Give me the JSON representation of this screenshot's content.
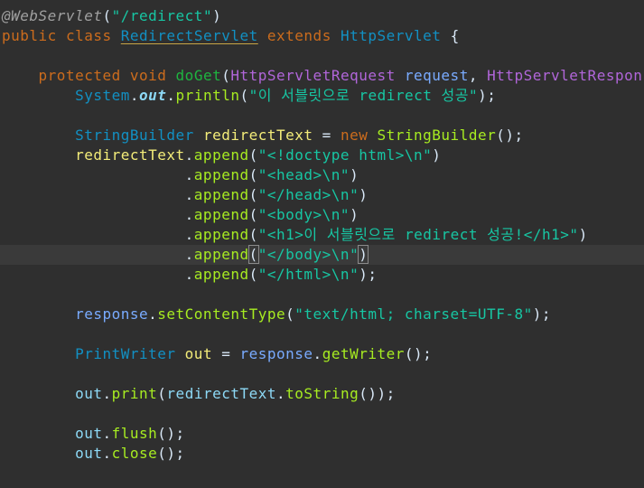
{
  "editor": {
    "lines": [
      [
        {
          "t": "@WebServlet",
          "c": "annotation"
        },
        {
          "t": "(",
          "c": "plain"
        },
        {
          "t": "\"/redirect\"",
          "c": "string"
        },
        {
          "t": ")",
          "c": "plain"
        }
      ],
      [
        {
          "t": "public",
          "c": "keyword"
        },
        {
          "t": " ",
          "c": "plain"
        },
        {
          "t": "class",
          "c": "keyword"
        },
        {
          "t": " ",
          "c": "plain"
        },
        {
          "t": "RedirectServlet",
          "c": "class-ul"
        },
        {
          "t": " ",
          "c": "plain"
        },
        {
          "t": "extends",
          "c": "keyword"
        },
        {
          "t": " ",
          "c": "plain"
        },
        {
          "t": "HttpServlet",
          "c": "class"
        },
        {
          "t": " {",
          "c": "plain"
        }
      ],
      [],
      [
        {
          "t": "    ",
          "c": "plain"
        },
        {
          "t": "protected",
          "c": "keyword"
        },
        {
          "t": " ",
          "c": "plain"
        },
        {
          "t": "void",
          "c": "keyword"
        },
        {
          "t": " ",
          "c": "plain"
        },
        {
          "t": "doGet",
          "c": "decl-method"
        },
        {
          "t": "(",
          "c": "plain"
        },
        {
          "t": "HttpServletRequest",
          "c": "interface"
        },
        {
          "t": " ",
          "c": "plain"
        },
        {
          "t": "request",
          "c": "param"
        },
        {
          "t": ", ",
          "c": "plain"
        },
        {
          "t": "HttpServletResponse",
          "c": "interface"
        }
      ],
      [
        {
          "t": "        ",
          "c": "plain"
        },
        {
          "t": "System",
          "c": "class"
        },
        {
          "t": ".",
          "c": "plain"
        },
        {
          "t": "out",
          "c": "static"
        },
        {
          "t": ".",
          "c": "plain"
        },
        {
          "t": "println",
          "c": "method"
        },
        {
          "t": "(",
          "c": "plain"
        },
        {
          "t": "\"이 서블릿으로 redirect 성공\"",
          "c": "string"
        },
        {
          "t": ");",
          "c": "plain"
        }
      ],
      [],
      [
        {
          "t": "        ",
          "c": "plain"
        },
        {
          "t": "StringBuilder",
          "c": "class"
        },
        {
          "t": " ",
          "c": "plain"
        },
        {
          "t": "redirectText",
          "c": "local"
        },
        {
          "t": " = ",
          "c": "plain"
        },
        {
          "t": "new",
          "c": "keyword"
        },
        {
          "t": " ",
          "c": "plain"
        },
        {
          "t": "StringBuilder",
          "c": "method"
        },
        {
          "t": "();",
          "c": "plain"
        }
      ],
      [
        {
          "t": "        ",
          "c": "plain"
        },
        {
          "t": "redirectText",
          "c": "local"
        },
        {
          "t": ".",
          "c": "plain"
        },
        {
          "t": "append",
          "c": "method"
        },
        {
          "t": "(",
          "c": "plain"
        },
        {
          "t": "\"<!doctype html>\\n\"",
          "c": "string"
        },
        {
          "t": ")",
          "c": "plain"
        }
      ],
      [
        {
          "t": "                    ",
          "c": "plain"
        },
        {
          "t": ".",
          "c": "plain"
        },
        {
          "t": "append",
          "c": "method"
        },
        {
          "t": "(",
          "c": "plain"
        },
        {
          "t": "\"<head>\\n\"",
          "c": "string"
        },
        {
          "t": ")",
          "c": "plain"
        }
      ],
      [
        {
          "t": "                    ",
          "c": "plain"
        },
        {
          "t": ".",
          "c": "plain"
        },
        {
          "t": "append",
          "c": "method"
        },
        {
          "t": "(",
          "c": "plain"
        },
        {
          "t": "\"</head>\\n\"",
          "c": "string"
        },
        {
          "t": ")",
          "c": "plain"
        }
      ],
      [
        {
          "t": "                    ",
          "c": "plain"
        },
        {
          "t": ".",
          "c": "plain"
        },
        {
          "t": "append",
          "c": "method"
        },
        {
          "t": "(",
          "c": "plain"
        },
        {
          "t": "\"<body>\\n\"",
          "c": "string"
        },
        {
          "t": ")",
          "c": "plain"
        }
      ],
      [
        {
          "t": "                    ",
          "c": "plain"
        },
        {
          "t": ".",
          "c": "plain"
        },
        {
          "t": "append",
          "c": "method"
        },
        {
          "t": "(",
          "c": "plain"
        },
        {
          "t": "\"<h1>이 서블릿으로 redirect 성공!</h1>\"",
          "c": "string"
        },
        {
          "t": ")",
          "c": "plain"
        }
      ],
      [
        {
          "t": "                    ",
          "c": "plain"
        },
        {
          "t": ".",
          "c": "plain"
        },
        {
          "t": "append",
          "c": "method"
        },
        {
          "t": "(",
          "c": "bracket-hl"
        },
        {
          "t": "\"</body>\\n\"",
          "c": "string"
        },
        {
          "t": ")",
          "c": "bracket-hl"
        },
        {
          "t": "",
          "c": "caret"
        }
      ],
      [
        {
          "t": "                    ",
          "c": "plain"
        },
        {
          "t": ".",
          "c": "plain"
        },
        {
          "t": "append",
          "c": "method"
        },
        {
          "t": "(",
          "c": "plain"
        },
        {
          "t": "\"</html>\\n\"",
          "c": "string"
        },
        {
          "t": ");",
          "c": "plain"
        }
      ],
      [],
      [
        {
          "t": "        ",
          "c": "plain"
        },
        {
          "t": "response",
          "c": "param"
        },
        {
          "t": ".",
          "c": "plain"
        },
        {
          "t": "setContentType",
          "c": "method"
        },
        {
          "t": "(",
          "c": "plain"
        },
        {
          "t": "\"text/html; charset=UTF-8\"",
          "c": "string"
        },
        {
          "t": ");",
          "c": "plain"
        }
      ],
      [],
      [
        {
          "t": "        ",
          "c": "plain"
        },
        {
          "t": "PrintWriter",
          "c": "class"
        },
        {
          "t": " ",
          "c": "plain"
        },
        {
          "t": "out",
          "c": "local"
        },
        {
          "t": " = ",
          "c": "plain"
        },
        {
          "t": "response",
          "c": "param"
        },
        {
          "t": ".",
          "c": "plain"
        },
        {
          "t": "getWriter",
          "c": "method"
        },
        {
          "t": "();",
          "c": "plain"
        }
      ],
      [],
      [
        {
          "t": "        ",
          "c": "plain"
        },
        {
          "t": "out",
          "c": "field"
        },
        {
          "t": ".",
          "c": "plain"
        },
        {
          "t": "print",
          "c": "method"
        },
        {
          "t": "(",
          "c": "plain"
        },
        {
          "t": "redirectText",
          "c": "field"
        },
        {
          "t": ".",
          "c": "plain"
        },
        {
          "t": "toString",
          "c": "method"
        },
        {
          "t": "());",
          "c": "plain"
        }
      ],
      [],
      [
        {
          "t": "        ",
          "c": "plain"
        },
        {
          "t": "out",
          "c": "field"
        },
        {
          "t": ".",
          "c": "plain"
        },
        {
          "t": "flush",
          "c": "method"
        },
        {
          "t": "();",
          "c": "plain"
        }
      ],
      [
        {
          "t": "        ",
          "c": "plain"
        },
        {
          "t": "out",
          "c": "field"
        },
        {
          "t": ".",
          "c": "plain"
        },
        {
          "t": "close",
          "c": "method"
        },
        {
          "t": "();",
          "c": "plain"
        }
      ]
    ]
  }
}
